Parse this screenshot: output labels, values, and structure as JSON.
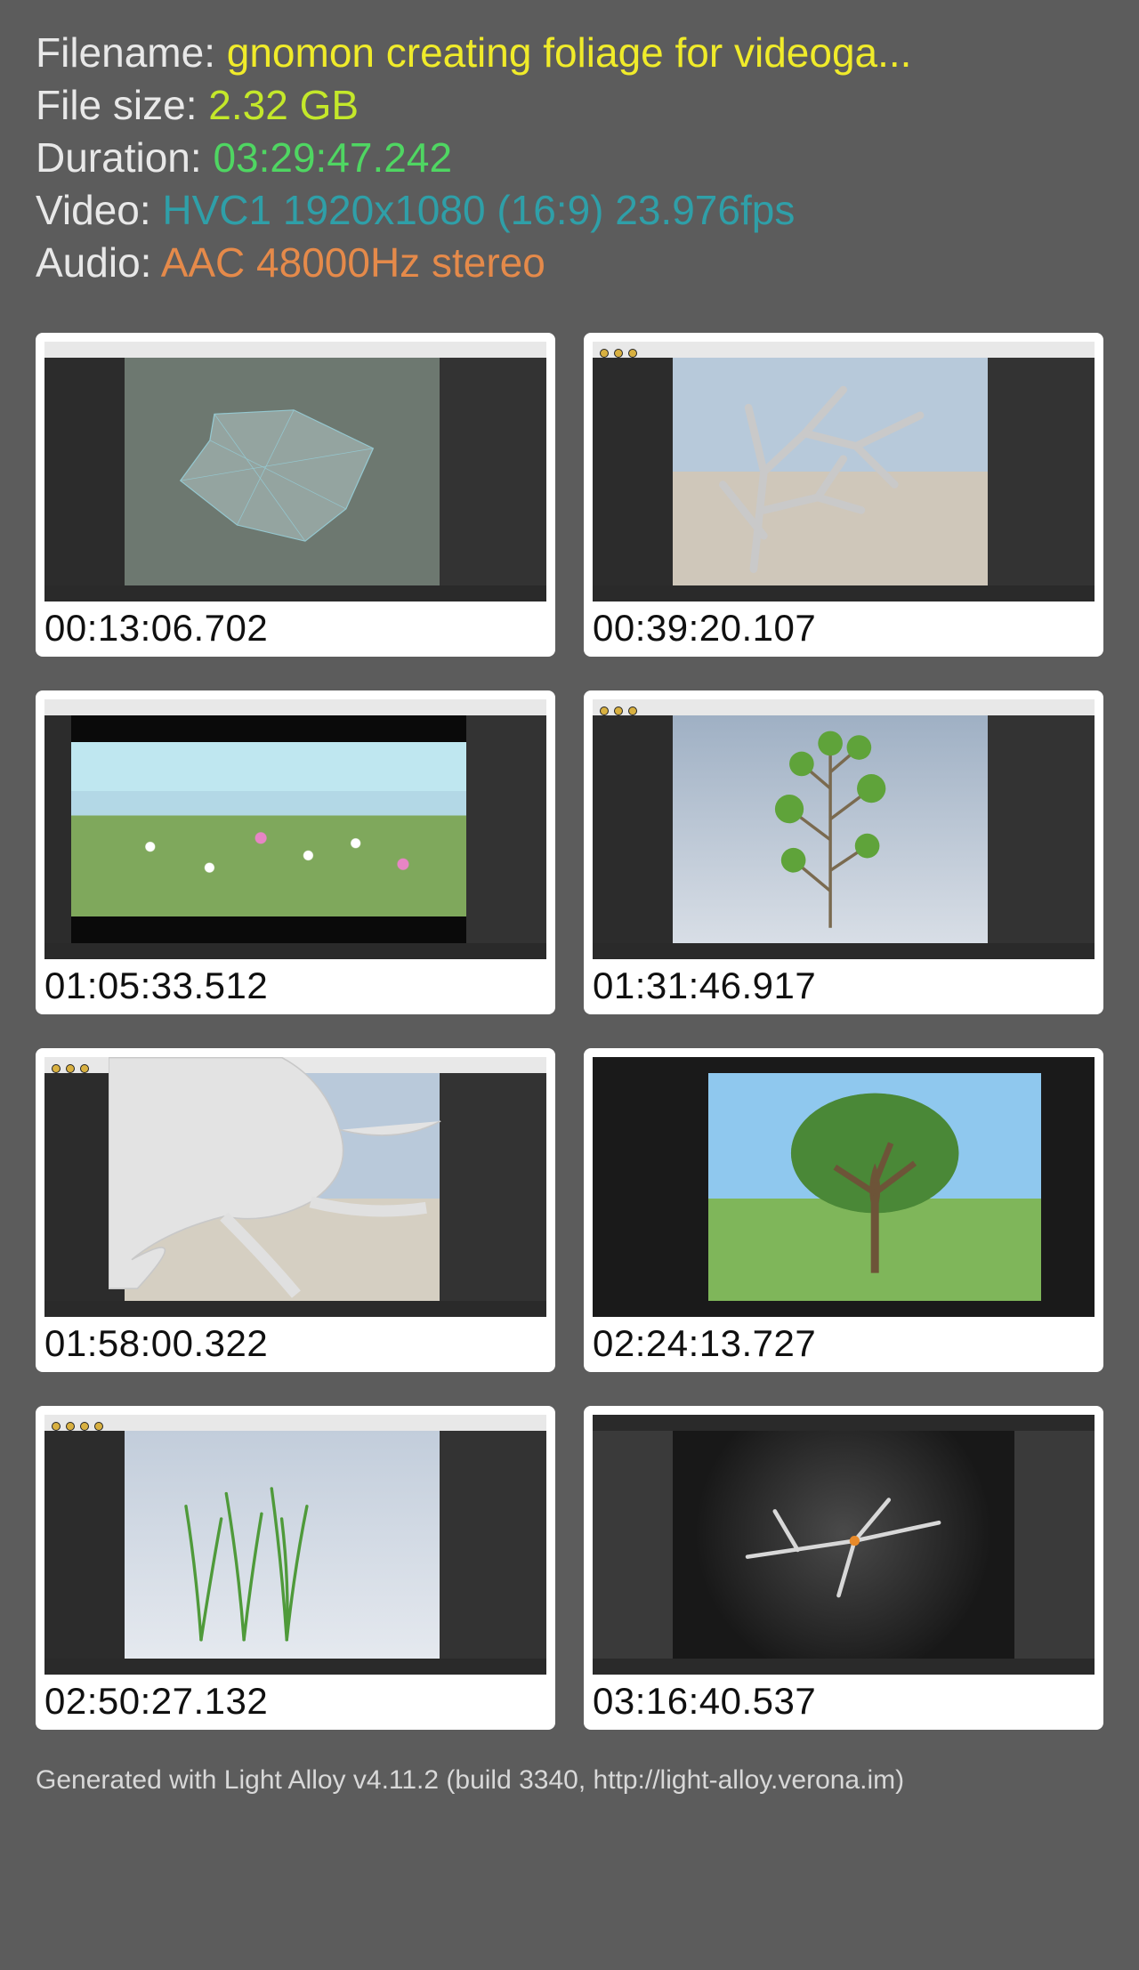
{
  "meta": {
    "filename_label": "Filename: ",
    "filename_value": "gnomon creating foliage for videoga...",
    "filesize_label": "File size: ",
    "filesize_value": "2.32 GB",
    "duration_label": "Duration: ",
    "duration_value": "03:29:47.242",
    "video_label": "Video: ",
    "video_value": "HVC1 1920x1080 (16:9) 23.976fps",
    "audio_label": "Audio: ",
    "audio_value": "AAC 48000Hz stereo"
  },
  "thumbnails": [
    {
      "timestamp": "00:13:06.702"
    },
    {
      "timestamp": "00:39:20.107"
    },
    {
      "timestamp": "01:05:33.512"
    },
    {
      "timestamp": "01:31:46.917"
    },
    {
      "timestamp": "01:58:00.322"
    },
    {
      "timestamp": "02:24:13.727"
    },
    {
      "timestamp": "02:50:27.132"
    },
    {
      "timestamp": "03:16:40.537"
    }
  ],
  "footer": {
    "text": "Generated with Light Alloy v4.11.2 (build 3340, http://light-alloy.verona.im)"
  }
}
